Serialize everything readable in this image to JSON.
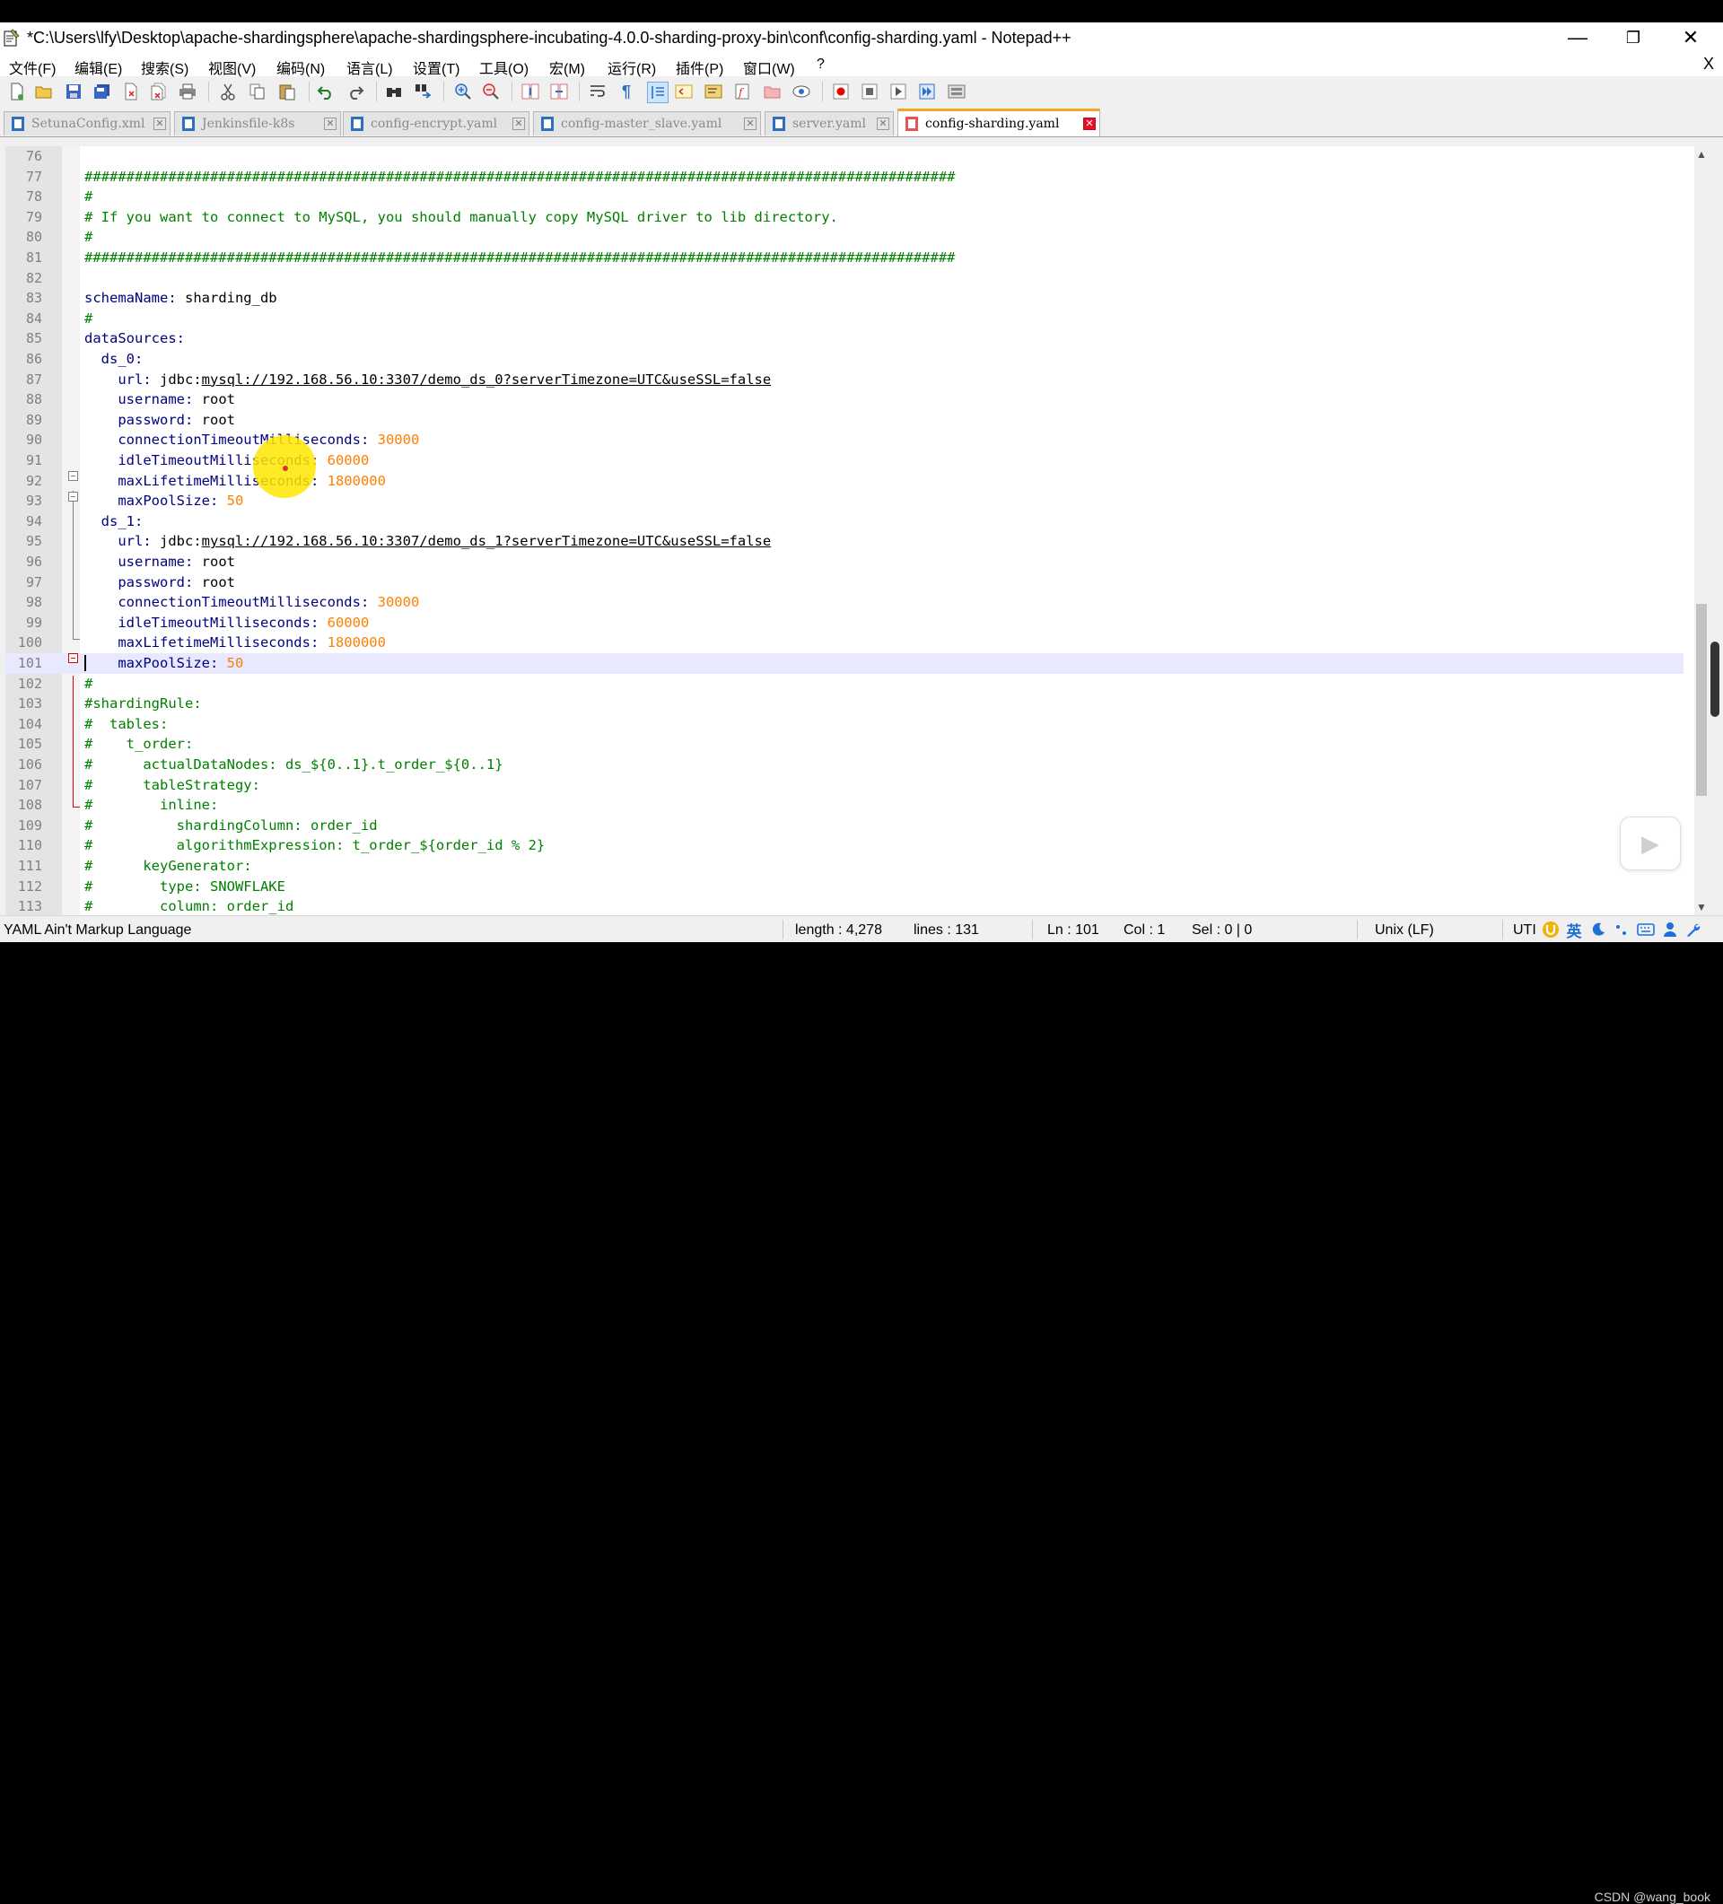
{
  "window": {
    "title": "*C:\\Users\\lfy\\Desktop\\apache-shardingsphere\\apache-shardingsphere-incubating-4.0.0-sharding-proxy-bin\\conf\\config-sharding.yaml - Notepad++",
    "minimize_glyph": "—",
    "restore_glyph": "❐",
    "close_glyph": "✕"
  },
  "menu": {
    "items": [
      "文件(F)",
      "编辑(E)",
      "搜索(S)",
      "视图(V)",
      "编码(N)",
      "语言(L)",
      "设置(T)",
      "工具(O)",
      "宏(M)",
      "运行(R)",
      "插件(P)",
      "窗口(W)",
      "?"
    ],
    "close_doc": "X"
  },
  "tabs": [
    {
      "label": "SetunaConfig.xml",
      "active": false,
      "icon_color": "#2f6fc0"
    },
    {
      "label": "Jenkinsfile-k8s",
      "active": false,
      "icon_color": "#2f6fc0"
    },
    {
      "label": "config-encrypt.yaml",
      "active": false,
      "icon_color": "#2f6fc0"
    },
    {
      "label": "config-master_slave.yaml",
      "active": false,
      "icon_color": "#2f6fc0"
    },
    {
      "label": "server.yaml",
      "active": false,
      "icon_color": "#2f6fc0"
    },
    {
      "label": "config-sharding.yaml",
      "active": true,
      "icon_color": "#e05555"
    }
  ],
  "tab_close_glyph": "✕",
  "editor": {
    "current_line": 101,
    "lines": [
      {
        "n": "76",
        "t": ""
      },
      {
        "n": "77",
        "t": "########################################################################################################",
        "k": "com"
      },
      {
        "n": "78",
        "t": "#",
        "k": "com"
      },
      {
        "n": "79",
        "t": "# If you want to connect to MySQL, you should manually copy MySQL driver to lib directory.",
        "k": "com"
      },
      {
        "n": "80",
        "t": "#",
        "k": "com"
      },
      {
        "n": "81",
        "t": "########################################################################################################",
        "k": "com"
      },
      {
        "n": "82",
        "t": ""
      },
      {
        "n": "83",
        "key": "schemaName:",
        "t": " sharding_db"
      },
      {
        "n": "84",
        "t": "#",
        "k": "com"
      },
      {
        "n": "85",
        "key": "dataSources:",
        "t": ""
      },
      {
        "n": "86",
        "ind": "  ",
        "key": "ds_0:",
        "t": ""
      },
      {
        "n": "87",
        "ind": "    ",
        "key": "url:",
        "t": " jdbc:",
        "url": "mysql://192.168.56.10:3307/demo_ds_0?serverTimezone=UTC&useSSL=false"
      },
      {
        "n": "88",
        "ind": "    ",
        "key": "username:",
        "t": " root"
      },
      {
        "n": "89",
        "ind": "    ",
        "key": "password:",
        "t": " root"
      },
      {
        "n": "90",
        "ind": "    ",
        "key": "connectionTimeoutMilliseconds:",
        "num": "30000"
      },
      {
        "n": "91",
        "ind": "    ",
        "key": "idleTimeoutMilliseconds:",
        "num": "60000"
      },
      {
        "n": "92",
        "ind": "    ",
        "key": "maxLifetimeMilliseconds:",
        "num": "1800000"
      },
      {
        "n": "93",
        "ind": "    ",
        "key": "maxPoolSize:",
        "num": "50"
      },
      {
        "n": "94",
        "ind": "  ",
        "key": "ds_1:",
        "t": ""
      },
      {
        "n": "95",
        "ind": "    ",
        "key": "url:",
        "t": " jdbc:",
        "url": "mysql://192.168.56.10:3307/demo_ds_1?serverTimezone=UTC&useSSL=false"
      },
      {
        "n": "96",
        "ind": "    ",
        "key": "username:",
        "t": " root"
      },
      {
        "n": "97",
        "ind": "    ",
        "key": "password:",
        "t": " root"
      },
      {
        "n": "98",
        "ind": "    ",
        "key": "connectionTimeoutMilliseconds:",
        "num": "30000"
      },
      {
        "n": "99",
        "ind": "    ",
        "key": "idleTimeoutMilliseconds:",
        "num": "60000"
      },
      {
        "n": "100",
        "ind": "    ",
        "key": "maxLifetimeMilliseconds:",
        "num": "1800000"
      },
      {
        "n": "101",
        "ind": "    ",
        "key": "maxPoolSize:",
        "num": "50"
      },
      {
        "n": "102",
        "t": "#",
        "k": "com"
      },
      {
        "n": "103",
        "t": "#shardingRule:",
        "k": "com"
      },
      {
        "n": "104",
        "t": "#  tables:",
        "k": "com"
      },
      {
        "n": "105",
        "t": "#    t_order:",
        "k": "com"
      },
      {
        "n": "106",
        "t": "#      actualDataNodes: ds_${0..1}.t_order_${0..1}",
        "k": "com"
      },
      {
        "n": "107",
        "t": "#      tableStrategy:",
        "k": "com"
      },
      {
        "n": "108",
        "t": "#        inline:",
        "k": "com"
      },
      {
        "n": "109",
        "t": "#          shardingColumn: order_id",
        "k": "com"
      },
      {
        "n": "110",
        "t": "#          algorithmExpression: t_order_${order_id % 2}",
        "k": "com"
      },
      {
        "n": "111",
        "t": "#      keyGenerator:",
        "k": "com"
      },
      {
        "n": "112",
        "t": "#        type: SNOWFLAKE",
        "k": "com"
      },
      {
        "n": "113",
        "t": "#        column: order_id",
        "k": "com"
      }
    ]
  },
  "statusbar": {
    "language": "YAML Ain't Markup Language",
    "length": "length : 4,278",
    "lines": "lines : 131",
    "ln": "Ln : 101",
    "col": "Col : 1",
    "sel": "Sel : 0 | 0",
    "eol": "Unix (LF)",
    "encoding": "UTI"
  },
  "tray": {
    "ime_lang": "英",
    "icons": [
      "ime-u-icon",
      "moon-icon",
      "punctuation-icon",
      "keyboard-icon",
      "user-icon",
      "wrench-icon"
    ]
  },
  "watermark": "CSDN @wang_book",
  "colors": {
    "comment": "#008000",
    "key": "#000080",
    "number": "#ff8000",
    "tab_accent": "#f5a623"
  }
}
